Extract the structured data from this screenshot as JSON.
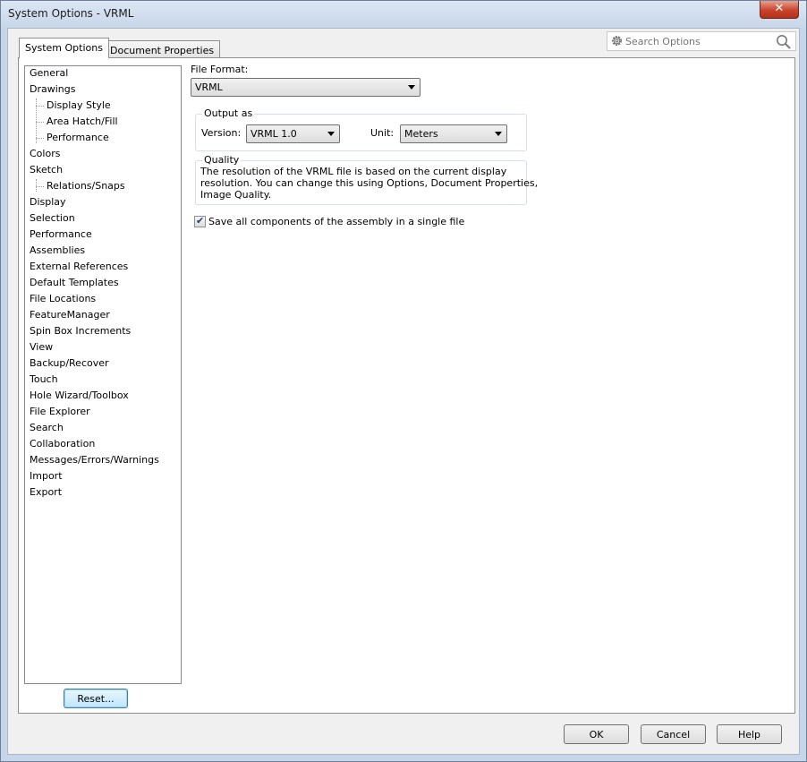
{
  "window": {
    "title": "System Options - VRML",
    "close_glyph": "✕"
  },
  "tabs": [
    {
      "label": "System Options",
      "active": true
    },
    {
      "label": "Document Properties",
      "active": false
    }
  ],
  "search": {
    "placeholder": "Search Options"
  },
  "tree": {
    "items": [
      {
        "label": "General",
        "level": 0
      },
      {
        "label": "Drawings",
        "level": 0
      },
      {
        "label": "Display Style",
        "level": 1
      },
      {
        "label": "Area Hatch/Fill",
        "level": 1
      },
      {
        "label": "Performance",
        "level": 1
      },
      {
        "label": "Colors",
        "level": 0
      },
      {
        "label": "Sketch",
        "level": 0
      },
      {
        "label": "Relations/Snaps",
        "level": 1
      },
      {
        "label": "Display",
        "level": 0
      },
      {
        "label": "Selection",
        "level": 0
      },
      {
        "label": "Performance",
        "level": 0
      },
      {
        "label": "Assemblies",
        "level": 0
      },
      {
        "label": "External References",
        "level": 0
      },
      {
        "label": "Default Templates",
        "level": 0
      },
      {
        "label": "File Locations",
        "level": 0
      },
      {
        "label": "FeatureManager",
        "level": 0
      },
      {
        "label": "Spin Box Increments",
        "level": 0
      },
      {
        "label": "View",
        "level": 0
      },
      {
        "label": "Backup/Recover",
        "level": 0
      },
      {
        "label": "Touch",
        "level": 0
      },
      {
        "label": "Hole Wizard/Toolbox",
        "level": 0
      },
      {
        "label": "File Explorer",
        "level": 0
      },
      {
        "label": "Search",
        "level": 0
      },
      {
        "label": "Collaboration",
        "level": 0
      },
      {
        "label": "Messages/Errors/Warnings",
        "level": 0
      },
      {
        "label": "Import",
        "level": 0
      },
      {
        "label": "Export",
        "level": 0
      }
    ]
  },
  "reset_label": "Reset...",
  "content": {
    "file_format_label": "File Format:",
    "file_format_value": "VRML",
    "output_as": {
      "legend": "Output as",
      "version_label": "Version:",
      "version_value": "VRML 1.0",
      "unit_label": "Unit:",
      "unit_value": "Meters"
    },
    "quality": {
      "legend": "Quality",
      "line1": "The resolution of the VRML file is based on the current display",
      "line2": "resolution. You can change this using Options, Document Properties,",
      "line3": "Image Quality."
    },
    "save_single_file": {
      "label": "Save all components of the assembly in a single file",
      "checked": true,
      "check_glyph": "✔"
    }
  },
  "buttons": {
    "ok": "OK",
    "cancel": "Cancel",
    "help": "Help"
  }
}
